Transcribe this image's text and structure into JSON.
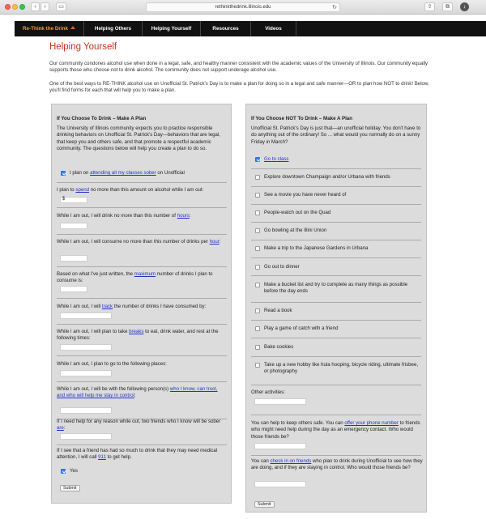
{
  "browser": {
    "url": "rethinkthedrink.illinois.edu"
  },
  "nav": {
    "items": [
      {
        "label": "Re-Think the Drink",
        "active": true
      },
      {
        "label": "Helping Others"
      },
      {
        "label": "Helping Yourself"
      },
      {
        "label": "Resources"
      },
      {
        "label": "Videos"
      }
    ]
  },
  "page": {
    "title": "Helping Yourself",
    "intro1": "Our community condones alcohol use when done in a legal, safe, and healthy manner consistent with the academic values of the University of Illinois. Our community equally supports those who choose not to drink alcohol. The community does not support underage alcohol use.",
    "intro2": "One of the best ways to RE-THINK alcohol use on Unofficial St. Patrick's Day is to make a plan for doing so in a legal and safe manner—OR to plan how NOT to drink! Below, you'll find forms for each that will help you to make a plan."
  },
  "left": {
    "heading": "If You Choose To Drink – Make A Plan",
    "intro": "The University of Illinois community expects you to practice responsible drinking behaviors on Unofficial St. Patrick's Day—behaviors that are legal, that keep you and others safe, and that promote a respectful academic community. The questions below will help you create a plan to do so.",
    "classes": {
      "pre": "I plan on ",
      "link": "attending all my classes sober",
      "post": " on Unofficial",
      "checked": true
    },
    "spend": {
      "pre": "I plan to ",
      "link": "spend",
      "post": " no more than this amount on alcohol while I am out:",
      "prefix": "$"
    },
    "hours": {
      "pre": "While I am out, I will drink no more than this number of ",
      "link": "hours",
      "post": ":"
    },
    "perhour": {
      "pre": "While I am out, I will consume no more than this number of drinks per ",
      "link": "hour",
      "post": ":"
    },
    "maximum": {
      "pre": "Based on what I've just written, the ",
      "link": "maximum",
      "post": " number of drinks I plan to consume is:"
    },
    "track": {
      "pre": "While I am out, I will ",
      "link": "track",
      "post": " the number of drinks I have consumed by:"
    },
    "breaks": {
      "pre": "While I am out, I will plan to take ",
      "link": "breaks",
      "post": " to eat, drink water, and rest at the following times:"
    },
    "places": "While I am out, I plan to go to the following places:",
    "persons": {
      "pre": "While I am out, I will be with the following person(s) ",
      "link": "who I know, can trust, and who will help me stay in control",
      "post": ":"
    },
    "friends": {
      "pre": "If I need help for any reason while out, two friends who I know will be sober ",
      "link": "are",
      "post": ":"
    },
    "call911": {
      "pre": "If I see that a friend has had so much to drink that they may need medical attention, I will call ",
      "link": "911",
      "post": " to get help."
    },
    "yes": {
      "label": "Yes",
      "checked": true
    },
    "submit": "Submit"
  },
  "right": {
    "heading": "If You Choose NOT To Drink – Make A Plan",
    "intro": "Unofficial St. Patrick's Day is just that—an unofficial holiday. You don't have to do anything out of the ordinary! So ... what would you normally do on a sunny Friday in March?",
    "options": [
      {
        "label": "Go to class",
        "link": true,
        "checked": true
      },
      {
        "label": "Explore downtown Champaign and/or Urbana with friends",
        "checked": false
      },
      {
        "label": "See a movie you have never heard of",
        "checked": false
      },
      {
        "label": "People-watch out on the Quad",
        "checked": false
      },
      {
        "label": "Go bowling at the Illini Union",
        "checked": false
      },
      {
        "label": "Make a trip to the Japanese Gardens in Urbana",
        "checked": false
      },
      {
        "label": "Go out to dinner",
        "checked": false
      },
      {
        "label": "Make a bucket list and try to complete as many things as possible before the day ends",
        "checked": false
      },
      {
        "label": "Read a book",
        "checked": false
      },
      {
        "label": "Play a game of catch with a friend",
        "checked": false
      },
      {
        "label": "Bake cookies",
        "checked": false
      },
      {
        "label": "Take up a new hobby like hula hooping, bicycle riding, ultimate frisbee, or photography",
        "checked": false
      }
    ],
    "other": "Other activities:",
    "phone": {
      "pre": "You can help to keep others safe. You can ",
      "link": "offer your phone number",
      "post": " to friends who might need help during the day as an emergency contact. Who would those friends be?"
    },
    "checkin": {
      "pre": "You can ",
      "link": "check in on friends",
      "post": " who plan to drink during Unofficial to see how they are doing, and if they are staying in control. Who would those friends be?"
    },
    "submit": "Submit"
  },
  "colors": {
    "accent_title": "#c8321f",
    "nav_bg": "#111111",
    "nav_active": "#e8a43a",
    "link": "#2134c9",
    "panel_bg": "#dcdcdc"
  }
}
